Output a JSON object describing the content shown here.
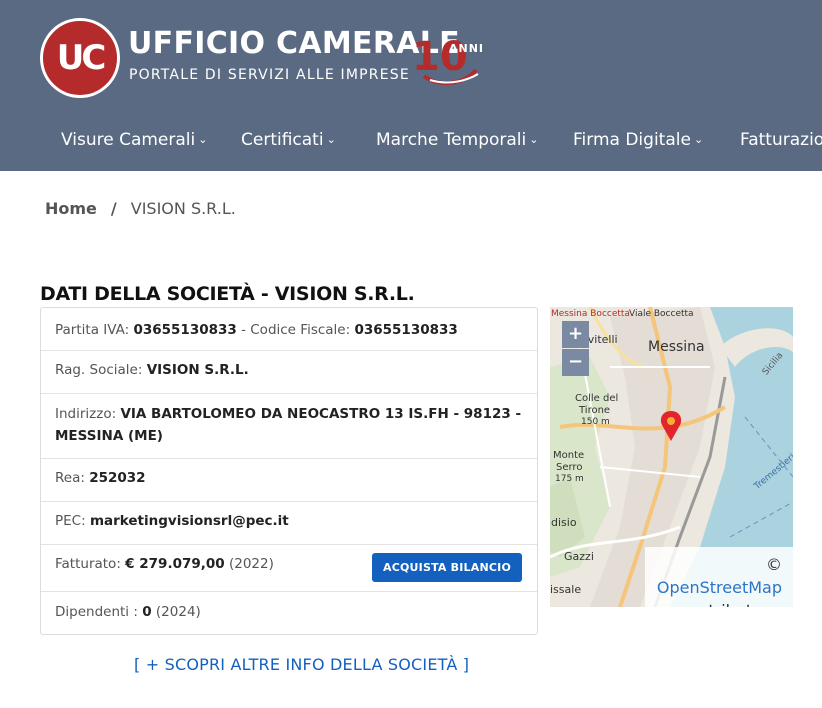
{
  "header": {
    "logo_text": "UC",
    "title": "UFFICIO CAMERALE",
    "subtitle": "PORTALE DI SERVIZI ALLE IMPRESE",
    "anni_text": "ANNI",
    "anni_number": "10",
    "brand_color": "#5a6a82",
    "logo_color": "#b52a2a"
  },
  "nav": {
    "items": [
      {
        "label": "Visure Camerali"
      },
      {
        "label": "Certificati"
      },
      {
        "label": "Marche Temporali"
      },
      {
        "label": "Firma Digitale"
      },
      {
        "label": "Fatturazione"
      }
    ]
  },
  "breadcrumb": {
    "home": "Home",
    "separator": "/",
    "current": "VISION S.R.L."
  },
  "section": {
    "title": "DATI DELLA SOCIETÀ - VISION S.R.L."
  },
  "company": {
    "piva_label": "Partita IVA:",
    "piva": "03655130833",
    "cf_label": "- Codice Fiscale:",
    "cf": "03655130833",
    "rag_label": "Rag. Sociale:",
    "rag": "VISION S.R.L.",
    "addr_label": "Indirizzo:",
    "addr_line1": "VIA BARTOLOMEO DA NEOCASTRO 13 IS.FH - 98123 -",
    "addr_line2": "MESSINA (ME)",
    "rea_label": "Rea:",
    "rea": "252032",
    "pec_label": "PEC:",
    "pec": "marketingvisionsrl@pec.it",
    "fatt_label": "Fatturato:",
    "fatt": "€ 279.079,00",
    "fatt_year": "(2022)",
    "buy_button": "ACQUISTA BILANCIO",
    "dip_label": "Dipendenti :",
    "dip": "0",
    "dip_year": "(2024)",
    "button_color": "#1460bf"
  },
  "map": {
    "zoom_in": "+",
    "zoom_out": "−",
    "attribution_symbol": "©",
    "attribution_link": "OpenStreetMap",
    "attribution_rest": "contributors.",
    "labels": {
      "messina": "Messina",
      "gravitelli": "Gravitelli",
      "via_boccetta": "Viale Boccetta",
      "messina_boccetta": "Messina Boccetta",
      "colle": "Colle del",
      "tirone": "Tirone",
      "tirone_m": "150 m",
      "monte": "Monte",
      "serro": "Serro",
      "serro_m": "175 m",
      "sicilia": "Sicilia",
      "disio": "disio",
      "gazzi": "Gazzi",
      "issale": "issale",
      "trem": "Tremestieri"
    }
  },
  "more_link": "[ + SCOPRI ALTRE INFO DELLA SOCIETÀ ]"
}
